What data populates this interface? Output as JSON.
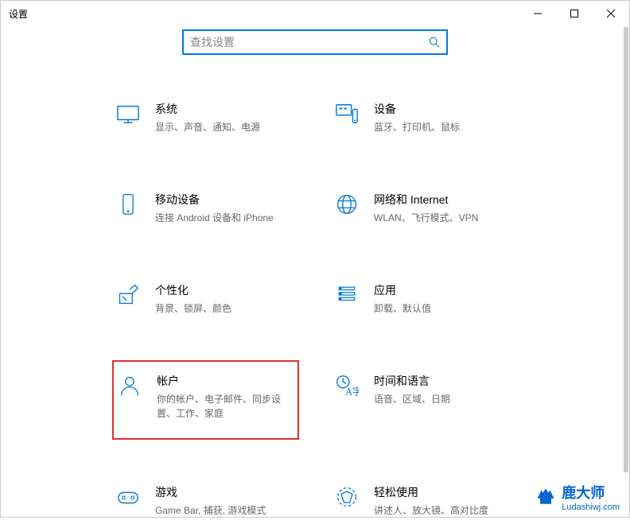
{
  "window": {
    "title": "设置"
  },
  "search": {
    "placeholder": "查找设置"
  },
  "categories": [
    {
      "id": "system",
      "title": "系统",
      "desc": "显示、声音、通知、电源",
      "icon": "monitor"
    },
    {
      "id": "devices",
      "title": "设备",
      "desc": "蓝牙、打印机、鼠标",
      "icon": "devices"
    },
    {
      "id": "phone",
      "title": "移动设备",
      "desc": "连接 Android 设备和 iPhone",
      "icon": "phone"
    },
    {
      "id": "network",
      "title": "网络和 Internet",
      "desc": "WLAN、飞行模式、VPN",
      "icon": "globe"
    },
    {
      "id": "personalization",
      "title": "个性化",
      "desc": "背景、锁屏、颜色",
      "icon": "pen"
    },
    {
      "id": "apps",
      "title": "应用",
      "desc": "卸载、默认值",
      "icon": "apps"
    },
    {
      "id": "accounts",
      "title": "帐户",
      "desc": "你的帐户、电子邮件、同步设置、工作、家庭",
      "icon": "person",
      "highlighted": true
    },
    {
      "id": "time",
      "title": "时间和语言",
      "desc": "语音、区域、日期",
      "icon": "time-language"
    },
    {
      "id": "gaming",
      "title": "游戏",
      "desc": "Game Bar, 捕获, 游戏模式",
      "icon": "gamepad"
    },
    {
      "id": "accessibility",
      "title": "轻松使用",
      "desc": "讲述人、放大镜、高对比度",
      "icon": "accessibility"
    }
  ],
  "watermark": {
    "brand": "鹿大师",
    "url": "Ludashiwj.com"
  }
}
